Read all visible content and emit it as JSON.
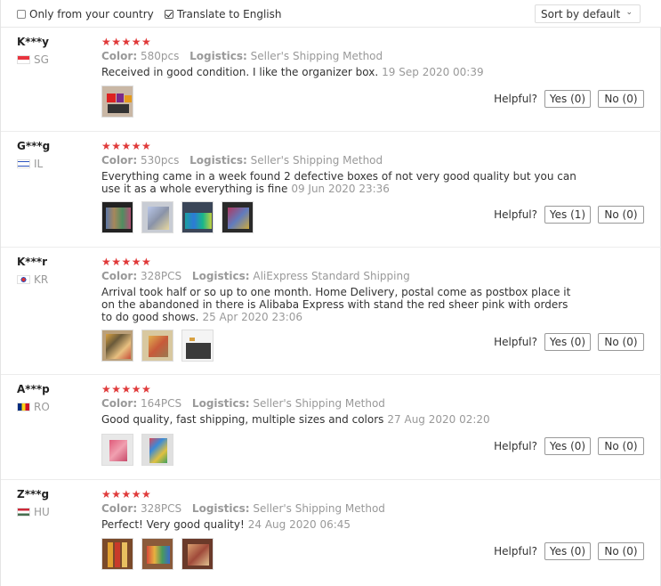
{
  "filters": {
    "country_label": "Only from your country",
    "country_checked": false,
    "translate_label": "Translate to English",
    "translate_checked": true,
    "sort_value": "Sort by default"
  },
  "labels": {
    "color": "Color:",
    "logistics": "Logistics:",
    "helpful": "Helpful?"
  },
  "reviews": [
    {
      "user": "K***y",
      "country": "SG",
      "stars": "★★★★★",
      "color": "580pcs",
      "logistics": "Seller's Shipping Method",
      "text": "Received in good condition. I like the organizer box.",
      "date": "19 Sep 2020 00:39",
      "yes": "Yes (0)",
      "no": "No (0)"
    },
    {
      "user": "G***g",
      "country": "IL",
      "stars": "★★★★★",
      "color": "530pcs",
      "logistics": "Seller's Shipping Method",
      "text": "Everything came in a week found 2 defective boxes of not very good quality but you can use it as a whole everything is fine",
      "date": "09 Jun 2020 23:36",
      "yes": "Yes (1)",
      "no": "No (0)"
    },
    {
      "user": "K***r",
      "country": "KR",
      "stars": "★★★★★",
      "color": "328PCS",
      "logistics": "AliExpress Standard Shipping",
      "text": "Arrival took half or so up to one month. Home Delivery, postal come as postbox place it on the abandoned in there is Alibaba Express with stand the red sheer pink with orders to do good shows.",
      "date": "25 Apr 2020 23:06",
      "yes": "Yes (0)",
      "no": "No (0)"
    },
    {
      "user": "A***p",
      "country": "RO",
      "stars": "★★★★★",
      "color": "164PCS",
      "logistics": "Seller's Shipping Method",
      "text": "Good quality, fast shipping, multiple sizes and colors",
      "date": "27 Aug 2020 02:20",
      "yes": "Yes (0)",
      "no": "No (0)"
    },
    {
      "user": "Z***g",
      "country": "HU",
      "stars": "★★★★★",
      "color": "328PCS",
      "logistics": "Seller's Shipping Method",
      "text": "Perfect! Very good quality!",
      "date": "24 Aug 2020 06:45",
      "yes": "Yes (0)",
      "no": "No (0)"
    }
  ]
}
